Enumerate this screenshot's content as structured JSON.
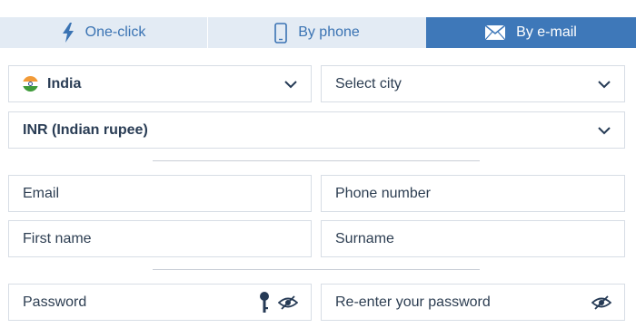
{
  "tabs": [
    {
      "label": "One-click",
      "icon": "lightning-icon",
      "active": false
    },
    {
      "label": "By phone",
      "icon": "phone-icon",
      "active": false
    },
    {
      "label": "By e-mail",
      "icon": "envelope-icon",
      "active": true
    }
  ],
  "country": {
    "value": "India",
    "icon": "india-flag-icon"
  },
  "city": {
    "placeholder": "Select city"
  },
  "currency": {
    "value": "INR (Indian rupee)"
  },
  "fields": {
    "email": "Email",
    "phone": "Phone number",
    "first_name": "First name",
    "surname": "Surname",
    "password": "Password",
    "reenter_password": "Re-enter your password"
  },
  "colors": {
    "active_tab": "#3e78b9",
    "inactive_tab": "#e3ebf4",
    "tab_text": "#3a73b3",
    "icon_dark": "#253a55"
  }
}
